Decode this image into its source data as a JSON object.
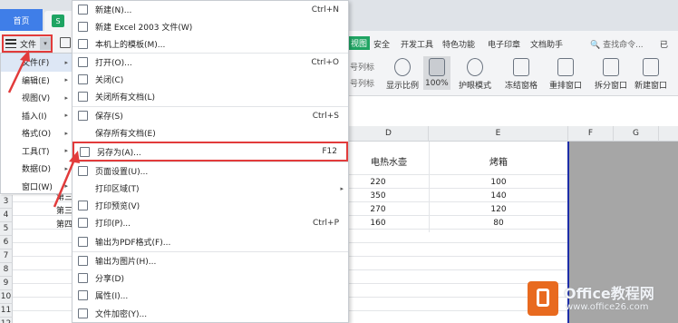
{
  "tabs": {
    "home": "首页",
    "doc_icon": "S"
  },
  "ribbon": {
    "file_label": "文件",
    "tabs": [
      "视图",
      "安全",
      "开发工具",
      "特色功能",
      "电子印章",
      "文档助手"
    ],
    "search": "查找命令...",
    "overflow": "已",
    "left_items": [
      "号列标",
      "号列标"
    ],
    "buttons": [
      "显示比例",
      "100%",
      "护眼模式",
      "冻结窗格",
      "重排窗口",
      "拆分窗口",
      "新建窗口"
    ]
  },
  "file_submenu": {
    "items": [
      {
        "label": "文件(F)",
        "arrow": "▸"
      },
      {
        "label": "编辑(E)",
        "arrow": "▸"
      },
      {
        "label": "视图(V)",
        "arrow": "▸"
      },
      {
        "label": "插入(I)",
        "arrow": "▸"
      },
      {
        "label": "格式(O)",
        "arrow": "▸"
      },
      {
        "label": "工具(T)",
        "arrow": "▸"
      },
      {
        "label": "数据(D)",
        "arrow": "▸"
      },
      {
        "label": "窗口(W)",
        "arrow": "▸"
      }
    ]
  },
  "main_menu": {
    "items": [
      {
        "label": "新建(N)...",
        "key": "Ctrl+N"
      },
      {
        "label": "新建 Excel 2003 文件(W)",
        "key": ""
      },
      {
        "label": "本机上的模板(M)...",
        "key": ""
      },
      {
        "label": "打开(O)...",
        "key": "Ctrl+O"
      },
      {
        "label": "关闭(C)",
        "key": ""
      },
      {
        "label": "关闭所有文档(L)",
        "key": ""
      },
      {
        "label": "保存(S)",
        "key": "Ctrl+S"
      },
      {
        "label": "保存所有文档(E)",
        "key": ""
      },
      {
        "label": "另存为(A)...",
        "key": "F12"
      },
      {
        "label": "页面设置(U)...",
        "key": ""
      },
      {
        "label": "打印区域(T)",
        "key": "",
        "arrow": "▸"
      },
      {
        "label": "打印预览(V)",
        "key": ""
      },
      {
        "label": "打印(P)...",
        "key": "Ctrl+P"
      },
      {
        "label": "输出为PDF格式(F)...",
        "key": ""
      },
      {
        "label": "输出为图片(H)...",
        "key": ""
      },
      {
        "label": "分享(D)",
        "key": ""
      },
      {
        "label": "属性(I)...",
        "key": ""
      },
      {
        "label": "文件加密(Y)...",
        "key": ""
      }
    ]
  },
  "sheet": {
    "columns": [
      "D",
      "E",
      "F",
      "G"
    ],
    "rows": [
      "3",
      "4",
      "5",
      "6",
      "7",
      "8",
      "9",
      "10",
      "11",
      "12"
    ],
    "header_d": "电热水壶",
    "header_e": "烤箱",
    "row_labels": [
      "第三",
      "第三",
      "第四"
    ],
    "d_values": [
      "220",
      "350",
      "270",
      "160"
    ],
    "e_values": [
      "100",
      "140",
      "120",
      "80"
    ]
  },
  "watermark": {
    "brand": "Office教程网",
    "url": "www.office26.com"
  }
}
